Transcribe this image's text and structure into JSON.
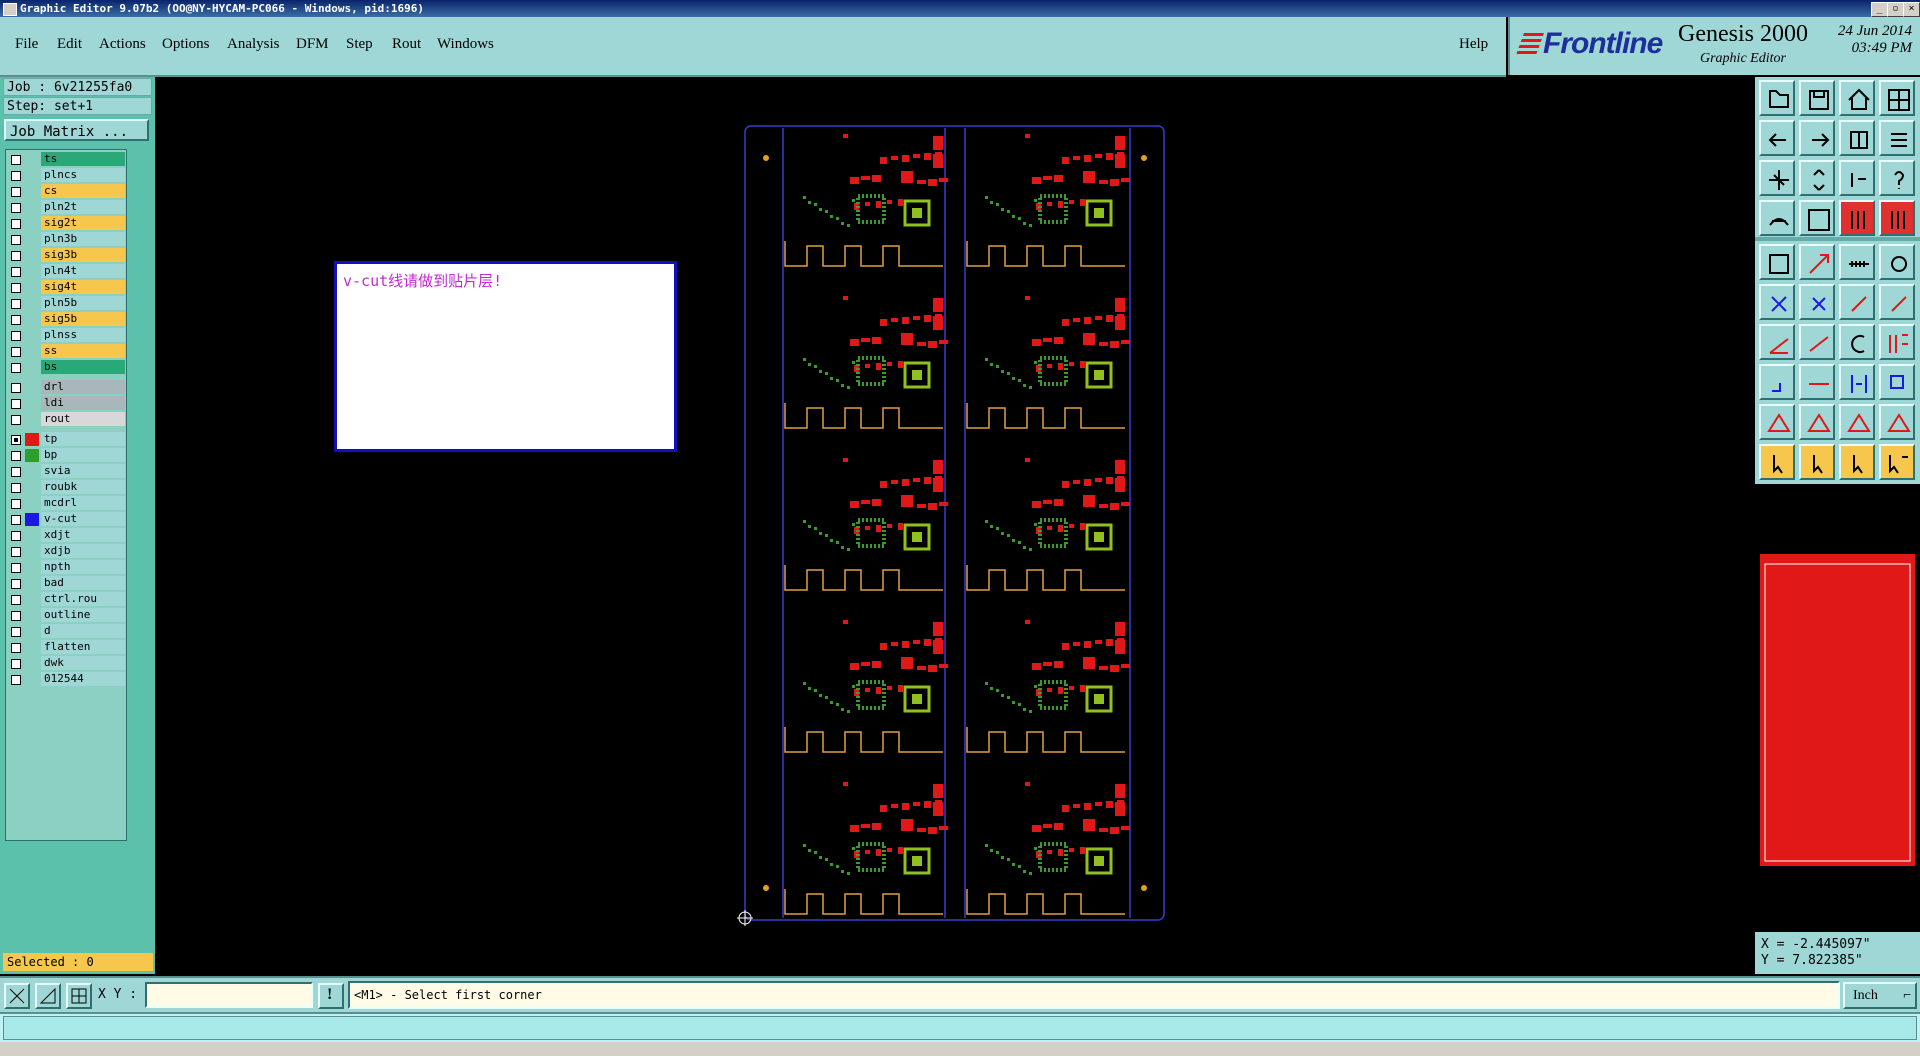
{
  "window": {
    "title": "Graphic Editor 9.07b2 (OO@NY-HYCAM-PC066 - Windows, pid:1696)"
  },
  "menu": [
    "File",
    "Edit",
    "Actions",
    "Options",
    "Analysis",
    "DFM",
    "Step",
    "Rout",
    "Windows"
  ],
  "help_label": "Help",
  "brand": {
    "logo": "Frontline",
    "product": "Genesis 2000",
    "subtitle": "Graphic Editor",
    "date": "24 Jun 2014",
    "time": "03:49 PM"
  },
  "job": {
    "job_label": "Job : 6v21255fa0",
    "step_label": "Step: set+1",
    "matrix_button": "Job Matrix ..."
  },
  "layers": [
    {
      "name": "ts",
      "color": "#2aa878"
    },
    {
      "name": "plncs",
      "color": "#9fd6d6"
    },
    {
      "name": "cs",
      "color": "#f7c64d"
    },
    {
      "name": "pln2t",
      "color": "#9fd6d6"
    },
    {
      "name": "sig2t",
      "color": "#f7c64d"
    },
    {
      "name": "pln3b",
      "color": "#9fd6d6"
    },
    {
      "name": "sig3b",
      "color": "#f7c64d"
    },
    {
      "name": "pln4t",
      "color": "#9fd6d6"
    },
    {
      "name": "sig4t",
      "color": "#f7c64d"
    },
    {
      "name": "pln5b",
      "color": "#9fd6d6"
    },
    {
      "name": "sig5b",
      "color": "#f7c64d"
    },
    {
      "name": "plnss",
      "color": "#9fd6d6"
    },
    {
      "name": "ss",
      "color": "#f7c64d"
    },
    {
      "name": "bs",
      "color": "#2aa878"
    },
    {
      "name": "drl",
      "color": "#a9b7bb"
    },
    {
      "name": "ldi",
      "color": "#a9b7bb"
    },
    {
      "name": "rout",
      "color": "#d8d8d8"
    },
    {
      "name": "tp",
      "color": "#9fd6d6",
      "swatch": "#e01818",
      "active": true
    },
    {
      "name": "bp",
      "color": "#9fd6d6",
      "swatch": "#2f9d2f"
    },
    {
      "name": "svia",
      "color": "#9fd6d6"
    },
    {
      "name": "roubk",
      "color": "#9fd6d6"
    },
    {
      "name": "mcdrl",
      "color": "#9fd6d6"
    },
    {
      "name": "v-cut",
      "color": "#9fd6d6",
      "swatch": "#1a1ae0"
    },
    {
      "name": "xdjt",
      "color": "#9fd6d6"
    },
    {
      "name": "xdjb",
      "color": "#9fd6d6"
    },
    {
      "name": "npth",
      "color": "#9fd6d6"
    },
    {
      "name": "bad",
      "color": "#9fd6d6"
    },
    {
      "name": "ctrl.rou",
      "color": "#9fd6d6"
    },
    {
      "name": "outline",
      "color": "#9fd6d6"
    },
    {
      "name": "d",
      "color": "#9fd6d6"
    },
    {
      "name": "flatten",
      "color": "#9fd6d6"
    },
    {
      "name": "dwk",
      "color": "#9fd6d6"
    },
    {
      "name": "012544",
      "color": "#9fd6d6"
    }
  ],
  "selected_label": "Selected : 0",
  "note_text": "v-cut线请做到贴片层!",
  "coords": {
    "x": "X = -2.445097\"",
    "y": "Y = 7.822385\""
  },
  "bottom": {
    "xy_label": "X Y :",
    "xy_value": "",
    "prompt": "<M1> - Select first corner",
    "unit": "Inch"
  },
  "tool_icons": [
    "open-icon",
    "save-icon",
    "home-icon",
    "window-layout-icon",
    "prev-icon",
    "next-icon",
    "snap-icon",
    "redraw-icon",
    "zoom-fit-icon",
    "zoom-step-icon",
    "scale-1-2-icon",
    "query-icon",
    "hand-icon",
    "grid-icon",
    "layer-stack-icon",
    "layer-stack-2-icon",
    "measure-icon",
    "resize-icon",
    "ruler-icon",
    "pad-icon",
    "connect-icon",
    "delete-icon",
    "move-icon",
    "move-2-icon",
    "line-angle-icon",
    "line-icon",
    "arc-icon",
    "dfm-icon",
    "add-pad-icon",
    "slot-icon",
    "attach-icon",
    "copy-icon",
    "triangle-icon",
    "triangle-2-icon",
    "triangle-3-icon",
    "triangle-4-icon",
    "select-icon",
    "select-2-icon",
    "select-3-icon",
    "select-net-icon"
  ],
  "colors": {
    "panel": "#9fd6d6",
    "layer_bg": "#5cc1ab",
    "pcb_red": "#e01818",
    "pcb_green": "#3c9a2c",
    "outline_blue": "#3a3ad0",
    "rout_yellow": "#e0a040"
  }
}
